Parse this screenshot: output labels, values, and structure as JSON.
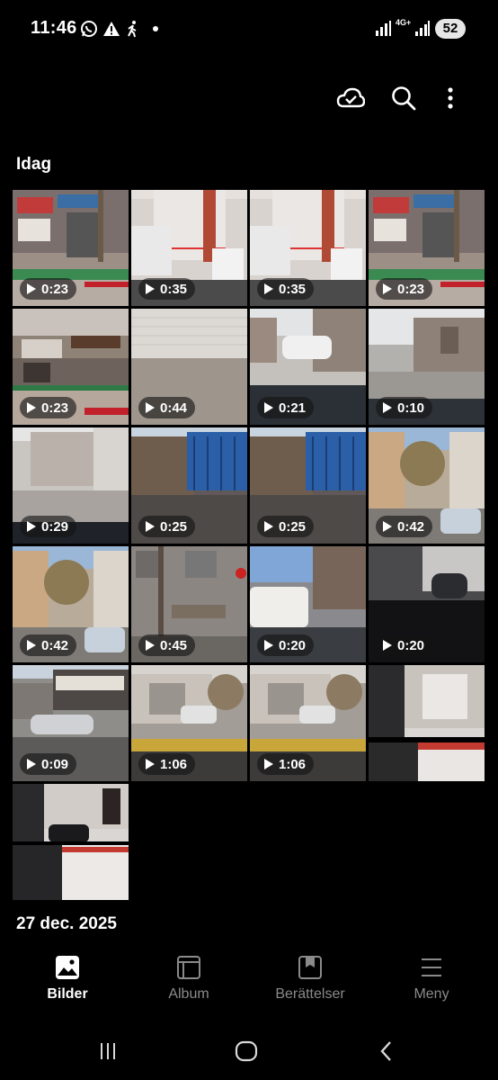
{
  "status_bar": {
    "time": "11:46",
    "icons": [
      "whatsapp-icon",
      "warning-icon",
      "walking-icon",
      "notification-dot"
    ],
    "network": "4G+",
    "battery": "52"
  },
  "toolbar": {
    "icons": [
      "cloud-sync-icon",
      "search-icon",
      "more-options-icon"
    ]
  },
  "sections": [
    {
      "title": "Idag",
      "items": [
        {
          "duration": "0:23",
          "scene": "shops"
        },
        {
          "duration": "0:35",
          "scene": "shutter-car"
        },
        {
          "duration": "0:35",
          "scene": "shutter-car"
        },
        {
          "duration": "0:23",
          "scene": "shops"
        },
        {
          "duration": "0:23",
          "scene": "shops2"
        },
        {
          "duration": "0:44",
          "scene": "shutter"
        },
        {
          "duration": "0:21",
          "scene": "street-car"
        },
        {
          "duration": "0:10",
          "scene": "street"
        },
        {
          "duration": "0:29",
          "scene": "buildings"
        },
        {
          "duration": "0:25",
          "scene": "gate"
        },
        {
          "duration": "0:25",
          "scene": "gate"
        },
        {
          "duration": "0:42",
          "scene": "trees-street"
        },
        {
          "duration": "0:42",
          "scene": "trees-street"
        },
        {
          "duration": "0:45",
          "scene": "wall"
        },
        {
          "duration": "0:20",
          "scene": "car-road"
        },
        {
          "duration": "0:20",
          "scene": "car-interior"
        },
        {
          "duration": "0:09",
          "scene": "shopfront"
        },
        {
          "duration": "1:06",
          "scene": "sidewalk"
        },
        {
          "duration": "1:06",
          "scene": "sidewalk"
        },
        {
          "duration": "",
          "scene": "collage"
        },
        {
          "duration": "",
          "scene": "collage2"
        }
      ]
    },
    {
      "title": "27 dec. 2025"
    }
  ],
  "bottom_nav": [
    {
      "label": "Bilder",
      "icon": "image-icon",
      "active": true
    },
    {
      "label": "Album",
      "icon": "album-icon",
      "active": false
    },
    {
      "label": "Berättelser",
      "icon": "stories-icon",
      "active": false
    },
    {
      "label": "Meny",
      "icon": "menu-icon",
      "active": false
    }
  ],
  "system_nav": [
    "recents-button",
    "home-button",
    "back-button"
  ]
}
